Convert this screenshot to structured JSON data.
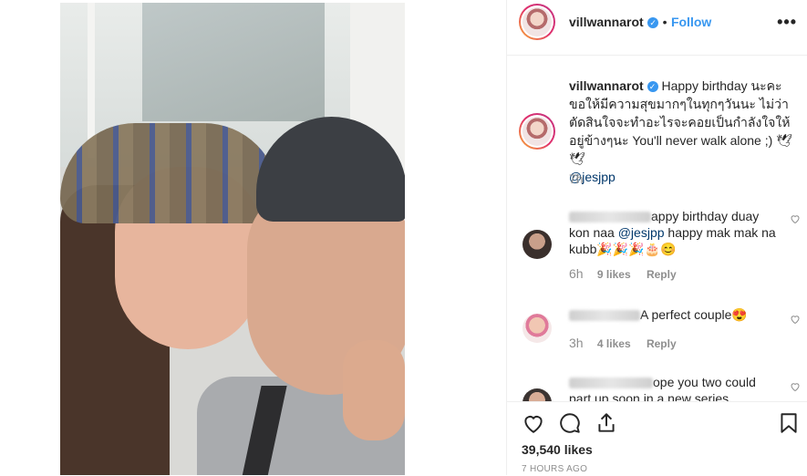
{
  "post": {
    "username": "villwannarot",
    "follow_label": "Follow",
    "dot": "•",
    "more": "•••",
    "verified_mark": "✓"
  },
  "caption": {
    "username": "villwannarot",
    "text": "Happy birthday นะคะ ขอให้มีความสุขมากๆในทุกๆวันนะ ไม่ว่าตัดสินใจจะทำอะไรจะคอยเป็นกำลังใจให้อยู่ข้างๆนะ You'll never walk alone ;) 🕊🕊",
    "mention": "@jesjpp",
    "time": "7h"
  },
  "comments": [
    {
      "text_before": "appy birthday duay kon naa ",
      "mention": "@jesjpp",
      "text_after": " happy mak mak na kubb🎉🎉🎉🎂😊",
      "time": "6h",
      "likes": "9 likes",
      "reply": "Reply"
    },
    {
      "text": "A perfect couple😍",
      "time": "3h",
      "likes": "4 likes",
      "reply": "Reply"
    },
    {
      "text": "ope you two could part up soon in a new series"
    }
  ],
  "footer": {
    "likes": "39,540 likes",
    "ago": "7 HOURS AGO"
  },
  "icons": {
    "like": "heart-icon",
    "comment": "comment-icon",
    "share": "share-icon",
    "save": "bookmark-icon"
  }
}
